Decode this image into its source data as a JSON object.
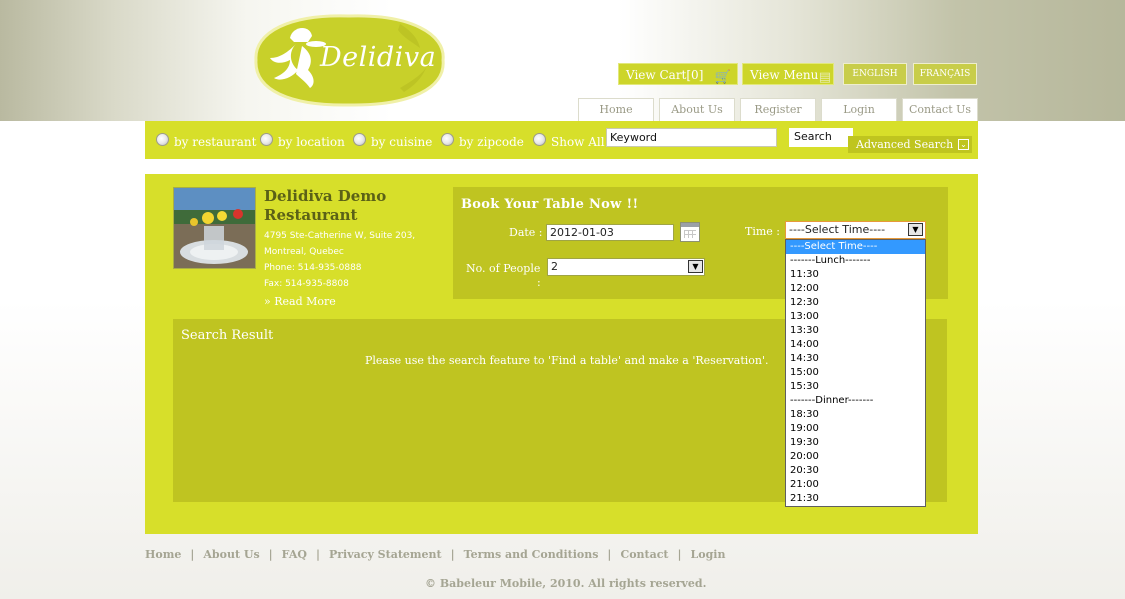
{
  "header": {
    "logo_text": "Delidiva",
    "view_cart": "View Cart[0]",
    "view_menu": "View Menu",
    "lang_en": "ENGLISH",
    "lang_fr": "FRANÇAIS",
    "nav": [
      "Home",
      "About Us",
      "Register",
      "Login",
      "Contact Us"
    ]
  },
  "search": {
    "options": [
      "by restaurant",
      "by location",
      "by cuisine",
      "by zipcode",
      "Show All"
    ],
    "keyword_value": "Keyword",
    "search_button": "Search",
    "advanced": "Advanced Search"
  },
  "restaurant": {
    "name": "Delidiva Demo Restaurant",
    "address1": "4795 Ste-Catherine W, Suite 203,",
    "address2": "Montreal, Quebec",
    "phone": "Phone: 514-935-0888",
    "fax": "Fax: 514-935-8808",
    "read_more": "Read More"
  },
  "booking": {
    "title": "Book Your Table Now !!",
    "date_label": "Date :",
    "date_value": "2012-01-03",
    "people_label": "No. of People",
    "people_colon": ":",
    "people_value": "2",
    "time_label": "Time :",
    "time_value": "----Select Time----",
    "time_options": [
      "----Select Time----",
      "-------Lunch-------",
      "11:30",
      "12:00",
      "12:30",
      "13:00",
      "13:30",
      "14:00",
      "14:30",
      "15:00",
      "15:30",
      "-------Dinner-------",
      "18:30",
      "19:00",
      "19:30",
      "20:00",
      "20:30",
      "21:00",
      "21:30"
    ],
    "selected_index": 0
  },
  "results": {
    "title": "Search Result",
    "message": "Please use the search feature to 'Find a table' and make a 'Reservation'."
  },
  "footer": {
    "links": [
      "Home",
      "About Us",
      "FAQ",
      "Privacy Statement",
      "Terms and Conditions",
      "Contact",
      "Login"
    ],
    "copyright": "© Babeleur Mobile, 2010. All rights reserved."
  },
  "colors": {
    "lime": "#d7df2a",
    "olive": "#bfc421",
    "highlight": "#3399ff"
  },
  "icons": [
    "cart-icon",
    "menu-icon",
    "calendar-icon",
    "chevron-down-icon",
    "double-chevron-icon",
    "chef-logo-icon"
  ]
}
